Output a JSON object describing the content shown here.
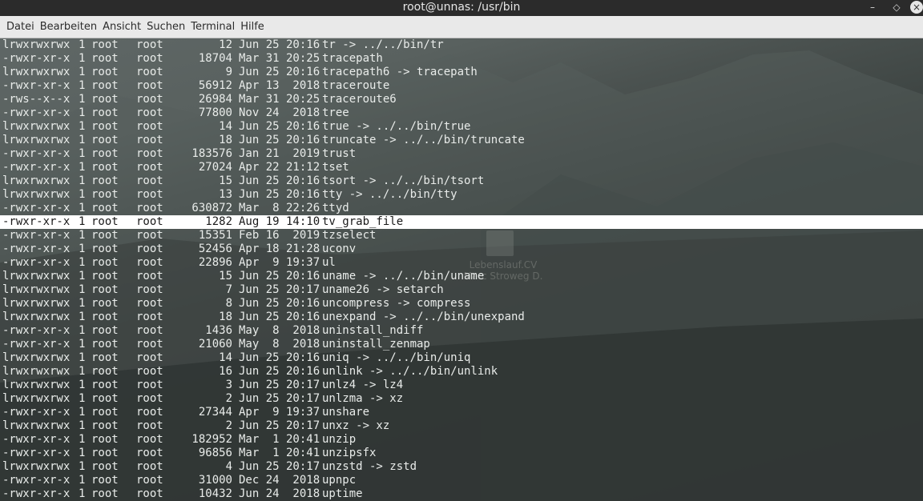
{
  "window": {
    "title": "root@unnas: /usr/bin"
  },
  "menu": [
    "Datei",
    "Bearbeiten",
    "Ansicht",
    "Suchen",
    "Terminal",
    "Hilfe"
  ],
  "desktop_icon": {
    "label_line1": "Lebenslauf.CV",
    "label_line2": "Marc Stroweg D."
  },
  "lines": [
    {
      "perm": "lrwxrwxrwx",
      "links": "1",
      "owner": "root",
      "group": "root",
      "size": "12",
      "date": "Jun 25 20:16",
      "name": "tr -> ../../bin/tr"
    },
    {
      "perm": "-rwxr-xr-x",
      "links": "1",
      "owner": "root",
      "group": "root",
      "size": "18704",
      "date": "Mar 31 20:25",
      "name": "tracepath"
    },
    {
      "perm": "lrwxrwxrwx",
      "links": "1",
      "owner": "root",
      "group": "root",
      "size": "9",
      "date": "Jun 25 20:16",
      "name": "tracepath6 -> tracepath"
    },
    {
      "perm": "-rwxr-xr-x",
      "links": "1",
      "owner": "root",
      "group": "root",
      "size": "56912",
      "date": "Apr 13  2018",
      "name": "traceroute"
    },
    {
      "perm": "-rws--x--x",
      "links": "1",
      "owner": "root",
      "group": "root",
      "size": "26984",
      "date": "Mar 31 20:25",
      "name": "traceroute6"
    },
    {
      "perm": "-rwxr-xr-x",
      "links": "1",
      "owner": "root",
      "group": "root",
      "size": "77800",
      "date": "Nov 24  2018",
      "name": "tree"
    },
    {
      "perm": "lrwxrwxrwx",
      "links": "1",
      "owner": "root",
      "group": "root",
      "size": "14",
      "date": "Jun 25 20:16",
      "name": "true -> ../../bin/true"
    },
    {
      "perm": "lrwxrwxrwx",
      "links": "1",
      "owner": "root",
      "group": "root",
      "size": "18",
      "date": "Jun 25 20:16",
      "name": "truncate -> ../../bin/truncate"
    },
    {
      "perm": "-rwxr-xr-x",
      "links": "1",
      "owner": "root",
      "group": "root",
      "size": "183576",
      "date": "Jan 21  2019",
      "name": "trust"
    },
    {
      "perm": "-rwxr-xr-x",
      "links": "1",
      "owner": "root",
      "group": "root",
      "size": "27024",
      "date": "Apr 22 21:12",
      "name": "tset"
    },
    {
      "perm": "lrwxrwxrwx",
      "links": "1",
      "owner": "root",
      "group": "root",
      "size": "15",
      "date": "Jun 25 20:16",
      "name": "tsort -> ../../bin/tsort"
    },
    {
      "perm": "lrwxrwxrwx",
      "links": "1",
      "owner": "root",
      "group": "root",
      "size": "13",
      "date": "Jun 25 20:16",
      "name": "tty -> ../../bin/tty"
    },
    {
      "perm": "-rwxr-xr-x",
      "links": "1",
      "owner": "root",
      "group": "root",
      "size": "630872",
      "date": "Mar  8 22:26",
      "name": "ttyd"
    },
    {
      "perm": "-rwxr-xr-x",
      "links": "1",
      "owner": "root",
      "group": "root",
      "size": "1282",
      "date": "Aug 19 14:10",
      "name": "tv_grab_file",
      "selected": true
    },
    {
      "perm": "-rwxr-xr-x",
      "links": "1",
      "owner": "root",
      "group": "root",
      "size": "15351",
      "date": "Feb 16  2019",
      "name": "tzselect"
    },
    {
      "perm": "-rwxr-xr-x",
      "links": "1",
      "owner": "root",
      "group": "root",
      "size": "52456",
      "date": "Apr 18 21:28",
      "name": "uconv"
    },
    {
      "perm": "-rwxr-xr-x",
      "links": "1",
      "owner": "root",
      "group": "root",
      "size": "22896",
      "date": "Apr  9 19:37",
      "name": "ul"
    },
    {
      "perm": "lrwxrwxrwx",
      "links": "1",
      "owner": "root",
      "group": "root",
      "size": "15",
      "date": "Jun 25 20:16",
      "name": "uname -> ../../bin/uname"
    },
    {
      "perm": "lrwxrwxrwx",
      "links": "1",
      "owner": "root",
      "group": "root",
      "size": "7",
      "date": "Jun 25 20:17",
      "name": "uname26 -> setarch"
    },
    {
      "perm": "lrwxrwxrwx",
      "links": "1",
      "owner": "root",
      "group": "root",
      "size": "8",
      "date": "Jun 25 20:16",
      "name": "uncompress -> compress"
    },
    {
      "perm": "lrwxrwxrwx",
      "links": "1",
      "owner": "root",
      "group": "root",
      "size": "18",
      "date": "Jun 25 20:16",
      "name": "unexpand -> ../../bin/unexpand"
    },
    {
      "perm": "-rwxr-xr-x",
      "links": "1",
      "owner": "root",
      "group": "root",
      "size": "1436",
      "date": "May  8  2018",
      "name": "uninstall_ndiff"
    },
    {
      "perm": "-rwxr-xr-x",
      "links": "1",
      "owner": "root",
      "group": "root",
      "size": "21060",
      "date": "May  8  2018",
      "name": "uninstall_zenmap"
    },
    {
      "perm": "lrwxrwxrwx",
      "links": "1",
      "owner": "root",
      "group": "root",
      "size": "14",
      "date": "Jun 25 20:16",
      "name": "uniq -> ../../bin/uniq"
    },
    {
      "perm": "lrwxrwxrwx",
      "links": "1",
      "owner": "root",
      "group": "root",
      "size": "16",
      "date": "Jun 25 20:16",
      "name": "unlink -> ../../bin/unlink"
    },
    {
      "perm": "lrwxrwxrwx",
      "links": "1",
      "owner": "root",
      "group": "root",
      "size": "3",
      "date": "Jun 25 20:17",
      "name": "unlz4 -> lz4"
    },
    {
      "perm": "lrwxrwxrwx",
      "links": "1",
      "owner": "root",
      "group": "root",
      "size": "2",
      "date": "Jun 25 20:17",
      "name": "unlzma -> xz"
    },
    {
      "perm": "-rwxr-xr-x",
      "links": "1",
      "owner": "root",
      "group": "root",
      "size": "27344",
      "date": "Apr  9 19:37",
      "name": "unshare"
    },
    {
      "perm": "lrwxrwxrwx",
      "links": "1",
      "owner": "root",
      "group": "root",
      "size": "2",
      "date": "Jun 25 20:17",
      "name": "unxz -> xz"
    },
    {
      "perm": "-rwxr-xr-x",
      "links": "1",
      "owner": "root",
      "group": "root",
      "size": "182952",
      "date": "Mar  1 20:41",
      "name": "unzip"
    },
    {
      "perm": "-rwxr-xr-x",
      "links": "1",
      "owner": "root",
      "group": "root",
      "size": "96856",
      "date": "Mar  1 20:41",
      "name": "unzipsfx"
    },
    {
      "perm": "lrwxrwxrwx",
      "links": "1",
      "owner": "root",
      "group": "root",
      "size": "4",
      "date": "Jun 25 20:17",
      "name": "unzstd -> zstd"
    },
    {
      "perm": "-rwxr-xr-x",
      "links": "1",
      "owner": "root",
      "group": "root",
      "size": "31000",
      "date": "Dec 24  2018",
      "name": "upnpc"
    },
    {
      "perm": "-rwxr-xr-x",
      "links": "1",
      "owner": "root",
      "group": "root",
      "size": "10432",
      "date": "Jun 24  2018",
      "name": "uptime"
    }
  ]
}
